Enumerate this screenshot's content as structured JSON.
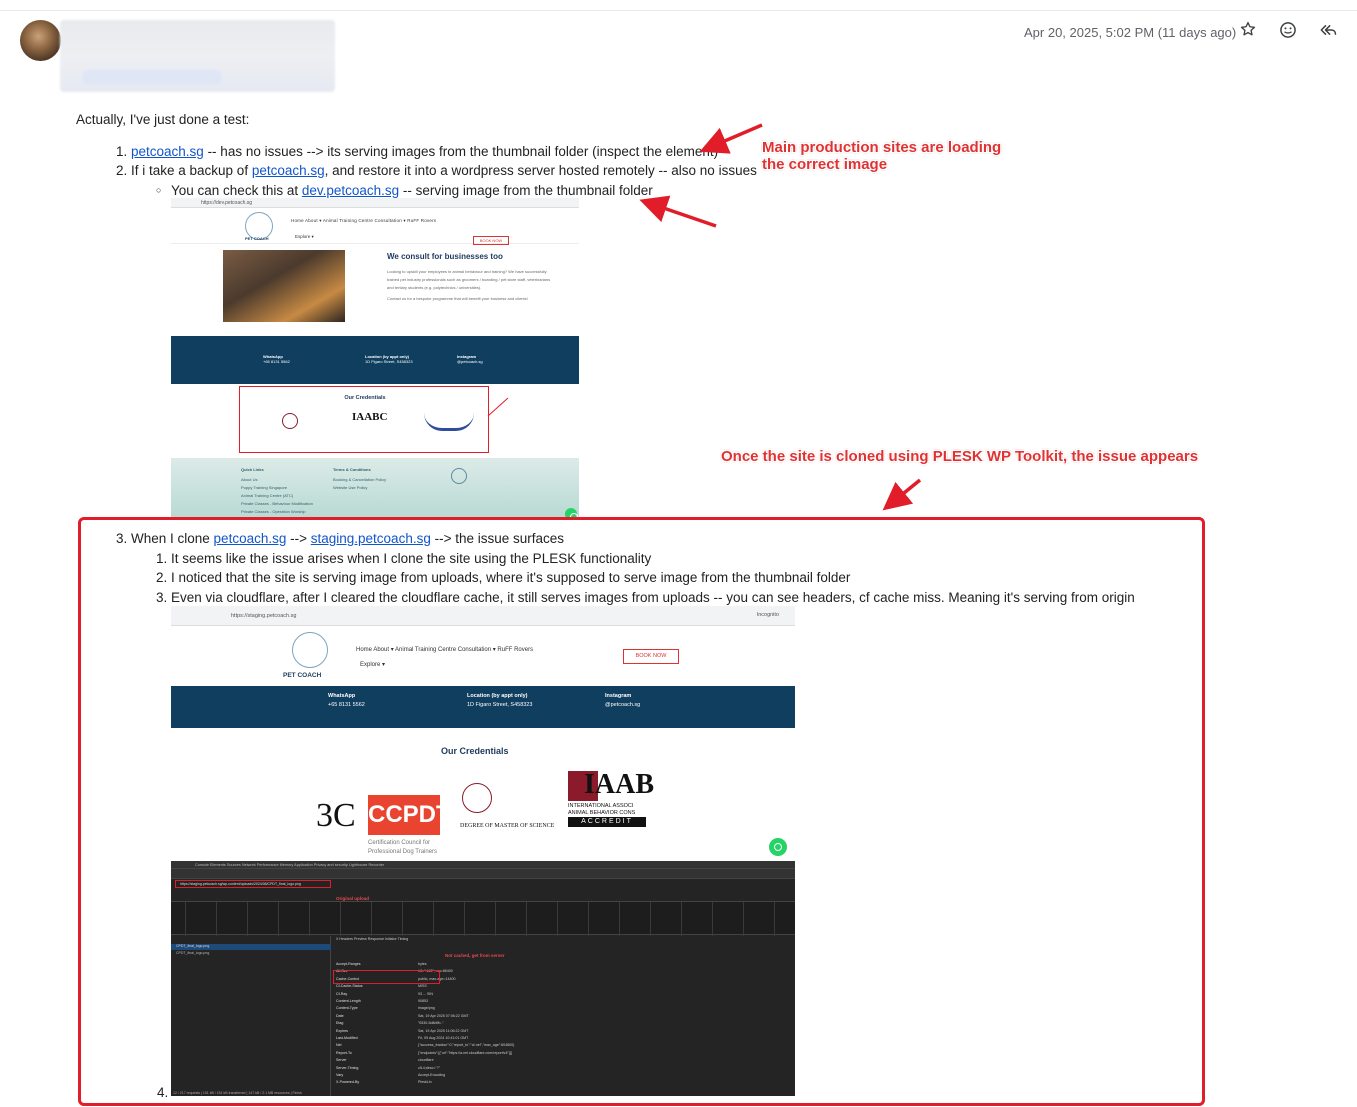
{
  "header": {
    "date": "Apr 20, 2025, 5:02 PM (11 days ago)",
    "icons": [
      "star-icon",
      "emoji-icon",
      "reply-all-icon"
    ]
  },
  "body": {
    "intro": "Actually, I've just done a test:",
    "items": [
      {
        "num": "1.",
        "link": "petcoach.sg",
        "text": " -- has no issues --> its serving images from the thumbnail folder (inspect the element)"
      },
      {
        "num": "2.",
        "pre": "If i take a backup of ",
        "link": "petcoach.sg",
        "text": ", and restore it into a wordpress server hosted remotely -- also no issues",
        "sub": {
          "pre": "You can check this at ",
          "link": "dev.petcoach.sg",
          "text": " -- serving image from the thumbnail folder"
        }
      },
      {
        "num": "3.",
        "pre": "When I clone ",
        "link": "petcoach.sg",
        "mid": " --> ",
        "link2": "staging.petcoach.sg",
        "text": " --> the issue surfaces",
        "sub": [
          {
            "num": "1.",
            "text": "It seems like the issue arises when I clone the site using the PLESK functionality"
          },
          {
            "num": "2.",
            "text": "I noticed that the site is serving image from uploads, where it's supposed to serve image from the thumbnail folder"
          },
          {
            "num": "3.",
            "text": "Even via cloudflare, after I cleared the cloudflare cache, it still serves images from uploads -- you can see headers, cf cache miss. Meaning it's serving from origin"
          }
        ]
      },
      {
        "num": "4."
      }
    ]
  },
  "annotations": {
    "main_production": "Main production sites are loading\nthe correct image",
    "once_cloned": "Once the site is cloned using PLESK WP Toolkit, the issue appears",
    "original_upload": "Original upload",
    "not_cached": "Not cached, get from server"
  },
  "shot1": {
    "url": "https://dev.petcoach.sg",
    "logo": "PET COACH",
    "nav": "Home   About ▾   Animal Training Centre   Consultation ▾   RuFF Rovers",
    "explore": "Explore ▾",
    "book": "BOOK NOW",
    "heading": "We consult for businesses too",
    "para": "Looking to upskill your employees in animal behaviour and training? We have successfully trained pet industry professionals such as groomers / boarding / pet store staff, veterinarians and tertiary students (e.g. polytechnics / universities).",
    "contact": "Contact us for a bespoke programme that will benefit your business and clients!",
    "whatsapp_label": "WhatsApp",
    "whatsapp": "+65 8131 5562",
    "location_label": "Location (by appt only)",
    "location": "1D Figaro Street, S458323",
    "instagram_label": "Instagram",
    "instagram": "@petcoach.sg",
    "credentials": "Our Credentials",
    "quick_links": "Quick Links",
    "links": "About Us\nPuppy Training Singapore\nAnimal Training Centre (ATC)\nPrivate Classes - Behaviour Modification\nPrivate Classes - Operation Worship",
    "terms": "Terms & Conditions",
    "terms_items": "Booking & Cancellation Policy\nWebsite Use Policy"
  },
  "shot2": {
    "url": "https://staging.petcoach.sg",
    "incognito": "Incognito",
    "logo": "PET COACH",
    "nav": "Home    About ▾    Animal Training Centre    Consultation ▾    RuFF Rovers",
    "explore": "Explore ▾",
    "book": "BOOK NOW",
    "whatsapp_label": "WhatsApp",
    "whatsapp": "+65 8131 5562",
    "location_label": "Location (by appt only)",
    "location": "1D Figaro Street, S458323",
    "instagram_label": "Instagram",
    "instagram": "@petcoach.sg",
    "credentials": "Our Credentials",
    "ccpdt": "CCPDT",
    "ccpdt_sub": "Certification Council for\nProfessional Dog Trainers",
    "degree": "DEGREE OF MASTER OF SCIENCE",
    "iaab": "IAAB",
    "iaab_sub": "INTERNATIONAL ASSOCI\nANIMAL BEHAVIOR CONS",
    "accredit": "ACCREDIT",
    "devtools_tabs": "Console   Elements   Sources   Network   Performance   Memory   Application   Privacy and security   Lighthouse   Recorder",
    "devtools_url": "https://staging.petcoach.sg/wp-content/uploads/2024/08/CPDT_final_logo.png",
    "files": [
      "CPDT_final_logo.png",
      "CPDT_final_logo.png"
    ],
    "header_tabs": "X   Headers   Preview   Response   Initiator   Timing",
    "headers": [
      [
        "Accept-Ranges",
        "bytes"
      ],
      [
        "Alt-Svc",
        "h3=\":443\"; ma=86400"
      ],
      [
        "Cache-Control",
        "public, max-age=14400"
      ],
      [
        "Cf-Cache-Status",
        "MISS"
      ],
      [
        "Cf-Ray",
        "93 ... SIN"
      ],
      [
        "Content-Length",
        "90853"
      ],
      [
        "Content-Type",
        "image/png"
      ],
      [
        "Date",
        "Sat, 19 Apr 2025 07:06:22 GMT"
      ],
      [
        "Etag",
        "\"0530-5d8d9b..\""
      ],
      [
        "Expires",
        "Sat, 19 Apr 2025 11:06:22 GMT"
      ],
      [
        "Last-Modified",
        "Fri, 09 Aug 2024 10:41:01 GMT"
      ],
      [
        "Nel",
        "{\"success_fraction\":0,\"report_to\":\"cf-nel\",\"max_age\":604800}"
      ],
      [
        "Report-To",
        "{\"endpoints\":[{\"url\":\"https://a.nel.cloudflare.com/report/v4\"}]}"
      ],
      [
        "Server",
        "cloudflare"
      ],
      [
        "Server-Timing",
        "cfL4;desc=\"?\""
      ],
      [
        "Vary",
        "Accept-Encoding"
      ],
      [
        "X-Powered-By",
        "PleskLin"
      ]
    ],
    "status": "12 / 217 requests  |  101 kB / 151 kB transferred  |  147 kB / 2.1 MB resources  |  Finish"
  }
}
